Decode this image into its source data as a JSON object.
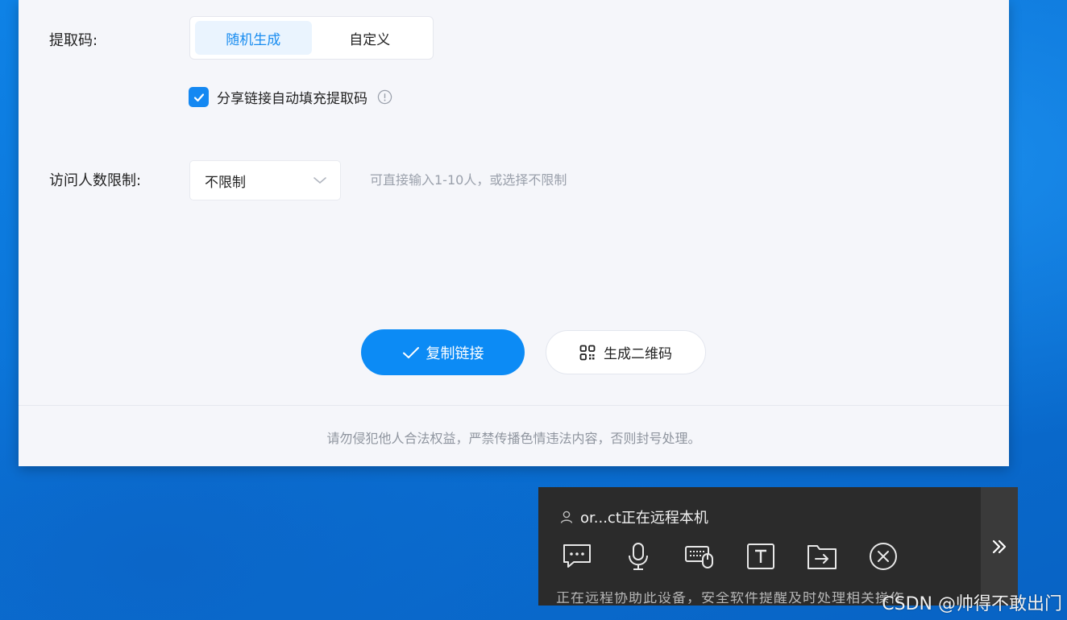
{
  "dialog": {
    "extract_code_label": "提取码:",
    "extract_options": [
      "随机生成",
      "自定义"
    ],
    "auto_fill_label": "分享链接自动填充提取码",
    "visit_limit_label": "访问人数限制:",
    "visit_limit_value": "不限制",
    "visit_limit_hint": "可直接输入1-10人，或选择不限制",
    "copy_link_button": "复制链接",
    "qr_button": "生成二维码",
    "footer_notice": "请勿侵犯他人合法权益，严禁传播色情违法内容，否则封号处理。"
  },
  "remote": {
    "status_text": "or...ct正在远程本机",
    "tools": [
      "chat-icon",
      "microphone-icon",
      "keyboard-mouse-icon",
      "text-icon",
      "file-transfer-icon",
      "disconnect-icon"
    ],
    "underlying_text": "正在远程协助此设备，安全软件提醒及时处理相关操作"
  },
  "watermark": "CSDN @帅得不敢出门",
  "colors": {
    "accent": "#0c8bf5",
    "active_bg": "#eaf4fe",
    "remote_bg": "#2b2b2b"
  }
}
